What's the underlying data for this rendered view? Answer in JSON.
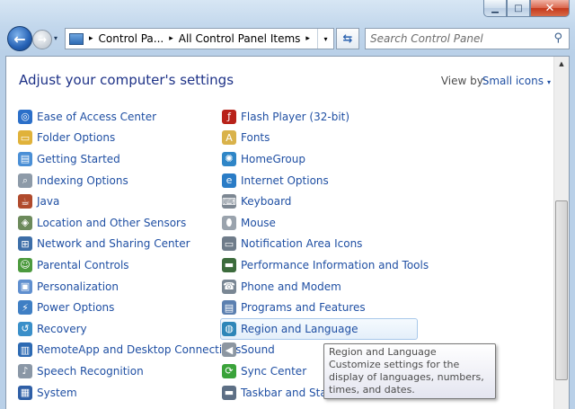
{
  "window": {
    "minimize_glyph": "▁",
    "maximize_glyph": "□",
    "close_glyph": "✕"
  },
  "nav": {
    "back_glyph": "←",
    "forward_glyph": "→",
    "history_glyph": "▾",
    "breadcrumbs": [
      "Control Pa...",
      "All Control Panel Items"
    ],
    "crumb_sep": "▸",
    "address_drop_glyph": "▾",
    "refresh_glyph": "⇆",
    "search_placeholder": "Search Control Panel",
    "search_glyph": "⚲"
  },
  "header": {
    "title": "Adjust your computer's settings",
    "view_by_label": "View by:",
    "view_by_value": "Small icons",
    "view_by_arrow": "▾"
  },
  "items_left": [
    {
      "label": "Ease of Access Center",
      "icon": "ease-of-access-icon",
      "color": "#2b6fc9",
      "glyph": "◎"
    },
    {
      "label": "Folder Options",
      "icon": "folder-options-icon",
      "color": "#e0b23a",
      "glyph": "▭"
    },
    {
      "label": "Getting Started",
      "icon": "getting-started-icon",
      "color": "#4a8fd6",
      "glyph": "▤"
    },
    {
      "label": "Indexing Options",
      "icon": "indexing-options-icon",
      "color": "#8d9aa8",
      "glyph": "⌕"
    },
    {
      "label": "Java",
      "icon": "java-icon",
      "color": "#b04a2c",
      "glyph": "☕"
    },
    {
      "label": "Location and Other Sensors",
      "icon": "location-sensors-icon",
      "color": "#6c8a5b",
      "glyph": "◈"
    },
    {
      "label": "Network and Sharing Center",
      "icon": "network-sharing-icon",
      "color": "#3d6ea8",
      "glyph": "⊞"
    },
    {
      "label": "Parental Controls",
      "icon": "parental-controls-icon",
      "color": "#4c9a3e",
      "glyph": "☺"
    },
    {
      "label": "Personalization",
      "icon": "personalization-icon",
      "color": "#5f8fcf",
      "glyph": "▣"
    },
    {
      "label": "Power Options",
      "icon": "power-options-icon",
      "color": "#3f7fc4",
      "glyph": "⚡"
    },
    {
      "label": "Recovery",
      "icon": "recovery-icon",
      "color": "#3a8fc9",
      "glyph": "↺"
    },
    {
      "label": "RemoteApp and Desktop Connections",
      "icon": "remoteapp-icon",
      "color": "#2d6ab3",
      "glyph": "▥"
    },
    {
      "label": "Speech Recognition",
      "icon": "speech-recognition-icon",
      "color": "#8a97a6",
      "glyph": "♪"
    },
    {
      "label": "System",
      "icon": "system-icon",
      "color": "#2f5fa6",
      "glyph": "▦"
    }
  ],
  "items_right": [
    {
      "label": "Flash Player (32-bit)",
      "icon": "flash-player-icon",
      "color": "#b8221a",
      "glyph": "ƒ"
    },
    {
      "label": "Fonts",
      "icon": "fonts-icon",
      "color": "#d9b24a",
      "glyph": "A"
    },
    {
      "label": "HomeGroup",
      "icon": "homegroup-icon",
      "color": "#2f86c7",
      "glyph": "✺"
    },
    {
      "label": "Internet Options",
      "icon": "internet-options-icon",
      "color": "#2a7cc6",
      "glyph": "e"
    },
    {
      "label": "Keyboard",
      "icon": "keyboard-icon",
      "color": "#7d8792",
      "glyph": "⌨"
    },
    {
      "label": "Mouse",
      "icon": "mouse-icon",
      "color": "#9aa3ad",
      "glyph": "⬮"
    },
    {
      "label": "Notification Area Icons",
      "icon": "notification-area-icon",
      "color": "#6f7c8a",
      "glyph": "▭"
    },
    {
      "label": "Performance Information and Tools",
      "icon": "performance-info-icon",
      "color": "#3c6b3c",
      "glyph": "▬"
    },
    {
      "label": "Phone and Modem",
      "icon": "phone-modem-icon",
      "color": "#7a8794",
      "glyph": "☎"
    },
    {
      "label": "Programs and Features",
      "icon": "programs-features-icon",
      "color": "#5c80b0",
      "glyph": "▤"
    },
    {
      "label": "Region and Language",
      "icon": "region-language-icon",
      "color": "#2e86b8",
      "glyph": "◍"
    },
    {
      "label": "Sound",
      "icon": "sound-icon",
      "color": "#8c96a1",
      "glyph": "◀"
    },
    {
      "label": "Sync Center",
      "icon": "sync-center-icon",
      "color": "#3aa33a",
      "glyph": "⟳"
    },
    {
      "label": "Taskbar and Start M",
      "icon": "taskbar-icon",
      "color": "#5d6f85",
      "glyph": "▬"
    }
  ],
  "tooltip": {
    "title": "Region and Language",
    "body": "Customize settings for the display of languages, numbers, times, and dates."
  },
  "scrollbar": {
    "up_glyph": "▲",
    "down_glyph": "▼"
  }
}
